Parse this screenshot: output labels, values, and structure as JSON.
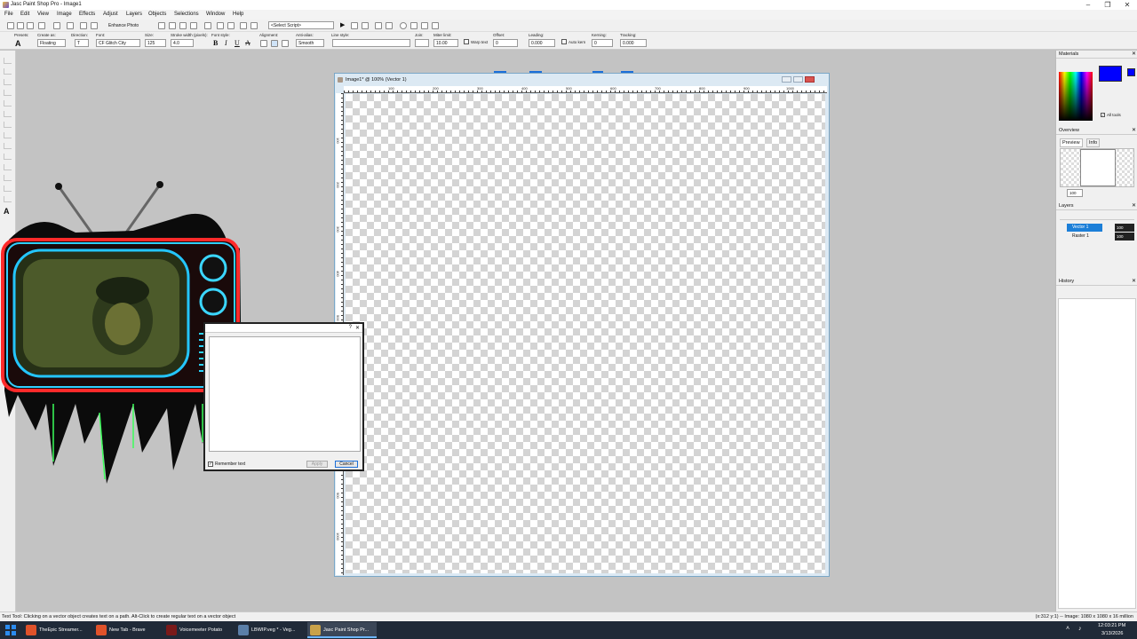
{
  "window": {
    "title": "Jasc Paint Shop Pro - Image1"
  },
  "menu": [
    "File",
    "Edit",
    "View",
    "Image",
    "Effects",
    "Adjust",
    "Layers",
    "Objects",
    "Selections",
    "Window",
    "Help"
  ],
  "toolbar": {
    "enhance_photo": "Enhance Photo",
    "script_select": "<Select Script>"
  },
  "tool_options": {
    "presets_label": "Presets:",
    "create_as_label": "Create as:",
    "create_as_value": "Floating",
    "direction_label": "Direction:",
    "font_label": "Font:",
    "font_value": "CF Glitch City",
    "size_label": "Size:",
    "size_value": "125",
    "stroke_label": "Stroke width (pixels):",
    "stroke_value": "4.0",
    "font_style_label": "Font style:",
    "bold": "B",
    "italic": "I",
    "underline": "U",
    "strike": "A",
    "alignment_label": "Alignment:",
    "antialias_label": "Anti-alias:",
    "antialias_value": "Smooth",
    "line_style_label": "Line style:",
    "join_label": "Join:",
    "miter_label": "Miter limit:",
    "miter_value": "10.00",
    "warp_text": "Warp text",
    "offset_label": "Offset:",
    "offset_value": "0",
    "leading_label": "Leading:",
    "leading_value": "0.000",
    "auto_kern": "Auto kern",
    "kerning_label": "Kerning:",
    "kerning_value": "0",
    "tracking_label": "Tracking:",
    "tracking_value": "0.000"
  },
  "document": {
    "title": "Image1* @ 100% (Vector 1)",
    "ruler_h": [
      "100",
      "200",
      "300",
      "400",
      "500",
      "600",
      "700",
      "800",
      "900",
      "1000"
    ],
    "ruler_v": [
      "100",
      "200",
      "300",
      "400",
      "500",
      "600",
      "700",
      "800",
      "900",
      "1000"
    ]
  },
  "text_dialog": {
    "remember_text": "Remember text",
    "apply": "Apply",
    "cancel": "Cancel"
  },
  "panels": {
    "materials": {
      "title": "Materials",
      "all_tools": "All tools",
      "fg_color": "#0000ff",
      "bg_color": "#ffffff"
    },
    "overview": {
      "title": "Overview",
      "tab_preview": "Preview",
      "tab_info": "Info",
      "zoom": "100"
    },
    "layers": {
      "title": "Layers",
      "items": [
        {
          "name": "Vector 1",
          "opacity": "100"
        },
        {
          "name": "Raster 1",
          "opacity": "100"
        }
      ]
    },
    "history": {
      "title": "History"
    }
  },
  "status": {
    "hint": "Text Tool: Clicking on a vector object creates text on a path. Alt-Click to create regular text on a vector object",
    "info": "(x:312 y:1) -- Image: 1080 x 1080 x 16 million"
  },
  "taskbar": {
    "items": [
      {
        "label": "TheEpic Streamer...",
        "icon_color": "#e0522a"
      },
      {
        "label": "New Tab - Brave",
        "icon_color": "#e0522a"
      },
      {
        "label": "Voicemeeter Potato",
        "icon_color": "#7a1a1a"
      },
      {
        "label": "LBWIP.veg * - Veg...",
        "icon_color": "#5b7fa8"
      },
      {
        "label": "Jasc Paint Shop Pr...",
        "icon_color": "#c9a24a"
      }
    ],
    "time": "12:03:21 PM",
    "date": "3/13/2026"
  }
}
